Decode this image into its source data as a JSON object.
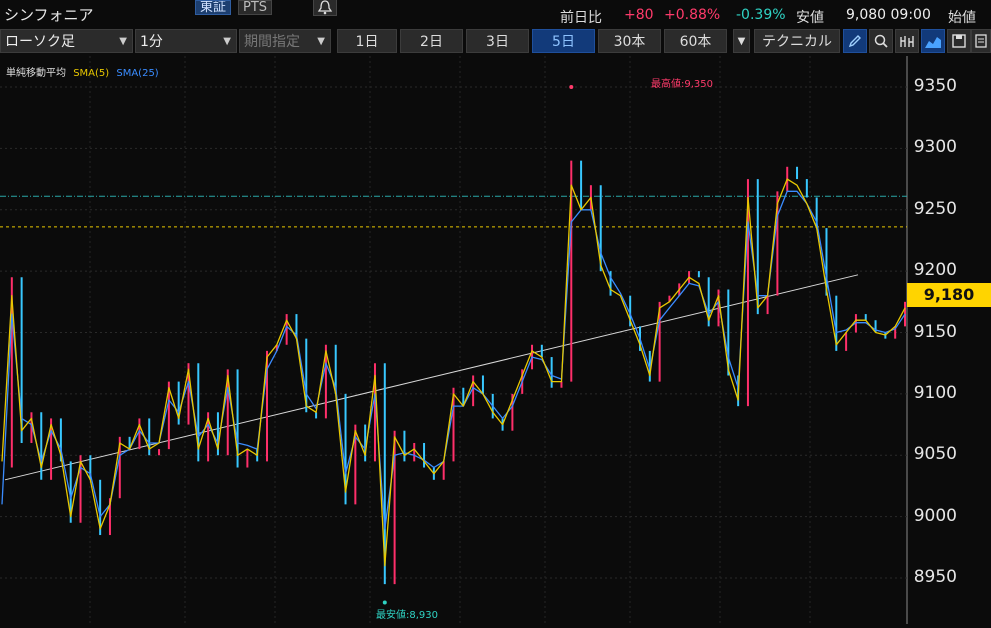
{
  "header": {
    "stock_name": "シンフォニア",
    "exchange_tabs": [
      "東証",
      "PTS"
    ],
    "prev_close_label": "前日比",
    "change": "+80",
    "change_pct": "+0.88%",
    "low_pct": "-0.39%",
    "low_label": "安値",
    "price_time": "9,080 09:00",
    "open_label": "始値"
  },
  "toolbar": {
    "chart_type": "ローソク足",
    "interval": "1分",
    "period_spec": "期間指定",
    "ranges": [
      "1日",
      "2日",
      "3日",
      "5日",
      "30本",
      "60本"
    ],
    "active_range": "5日",
    "technical": "テクニカル"
  },
  "legend": {
    "label": "単純移動平均",
    "sma5": "SMA(5)",
    "sma25": "SMA(25)",
    "colors": {
      "sma5": "#e8c800",
      "sma25": "#3a8cff"
    }
  },
  "annotations": {
    "high": "最高値:9,350",
    "low": "最安値:8,930"
  },
  "current_price": "9,180",
  "chart_data": {
    "type": "line",
    "ylim": [
      8910,
      9380
    ],
    "yticks": [
      9350,
      9300,
      9250,
      9200,
      9150,
      9100,
      9050,
      9000,
      8950
    ],
    "ytick_labels": [
      "9350",
      "9300",
      "9250",
      "9200",
      "9150",
      "9100",
      "9050",
      "9000",
      "8950"
    ],
    "high_price": 9350,
    "low_price": 8930,
    "last_price": 9180,
    "reference_lines": [
      {
        "value": 9261,
        "color": "#2aa7a7",
        "style": "dashdot"
      },
      {
        "value": 9236,
        "color": "#e8c800",
        "style": "dashed"
      }
    ],
    "trendline": {
      "from": 9030,
      "to": 9197
    },
    "price_series": [
      9040,
      9195,
      9060,
      9085,
      9030,
      9080,
      9045,
      8995,
      9050,
      9030,
      8985,
      9015,
      9065,
      9055,
      9080,
      9050,
      9055,
      9110,
      9075,
      9125,
      9045,
      9085,
      9050,
      9120,
      9040,
      9055,
      9045,
      9135,
      9140,
      9165,
      9145,
      9085,
      9080,
      9140,
      9100,
      9010,
      9075,
      9045,
      9125,
      8945,
      9070,
      9045,
      9060,
      9040,
      9030,
      9045,
      9105,
      9090,
      9115,
      9100,
      9080,
      9070,
      9100,
      9120,
      9140,
      9130,
      9105,
      9110,
      9290,
      9250,
      9270,
      9200,
      9180,
      9180,
      9155,
      9135,
      9110,
      9175,
      9180,
      9190,
      9200,
      9195,
      9155,
      9185,
      9115,
      9090,
      9275,
      9165,
      9180,
      9265,
      9285,
      9275,
      9260,
      9235,
      9180,
      9135,
      9150,
      9165,
      9160,
      9150,
      9145,
      9155,
      9175
    ],
    "sma5_series": [
      9045,
      9180,
      9070,
      9080,
      9040,
      9075,
      9050,
      9000,
      9045,
      9030,
      8990,
      9010,
      9060,
      9055,
      9075,
      9055,
      9060,
      9105,
      9080,
      9120,
      9055,
      9080,
      9055,
      9115,
      9050,
      9055,
      9050,
      9130,
      9140,
      9160,
      9145,
      9090,
      9085,
      9135,
      9100,
      9020,
      9070,
      9050,
      9115,
      8960,
      9065,
      9050,
      9055,
      9045,
      9035,
      9045,
      9100,
      9090,
      9110,
      9100,
      9085,
      9075,
      9095,
      9115,
      9135,
      9130,
      9110,
      9110,
      9270,
      9250,
      9260,
      9205,
      9185,
      9180,
      9160,
      9140,
      9115,
      9170,
      9175,
      9185,
      9195,
      9190,
      9160,
      9180,
      9120,
      9095,
      9260,
      9170,
      9180,
      9255,
      9275,
      9270,
      9255,
      9235,
      9185,
      9140,
      9150,
      9160,
      9160,
      9150,
      9148,
      9155,
      9170
    ],
    "sma25_series": [
      9010,
      9165,
      9080,
      9075,
      9045,
      9070,
      9055,
      9015,
      9040,
      9035,
      9000,
      9010,
      9050,
      9055,
      9070,
      9060,
      9060,
      9095,
      9085,
      9110,
      9065,
      9075,
      9060,
      9105,
      9060,
      9058,
      9055,
      9120,
      9135,
      9155,
      9148,
      9100,
      9088,
      9125,
      9105,
      9035,
      9065,
      9055,
      9100,
      8990,
      9050,
      9052,
      9050,
      9046,
      9040,
      9045,
      9090,
      9090,
      9105,
      9100,
      9090,
      9080,
      9090,
      9110,
      9130,
      9128,
      9115,
      9112,
      9240,
      9250,
      9250,
      9215,
      9195,
      9182,
      9165,
      9145,
      9120,
      9160,
      9170,
      9180,
      9190,
      9188,
      9165,
      9175,
      9130,
      9105,
      9240,
      9180,
      9180,
      9245,
      9265,
      9265,
      9255,
      9240,
      9195,
      9150,
      9152,
      9158,
      9158,
      9152,
      9150,
      9153,
      9165
    ]
  }
}
